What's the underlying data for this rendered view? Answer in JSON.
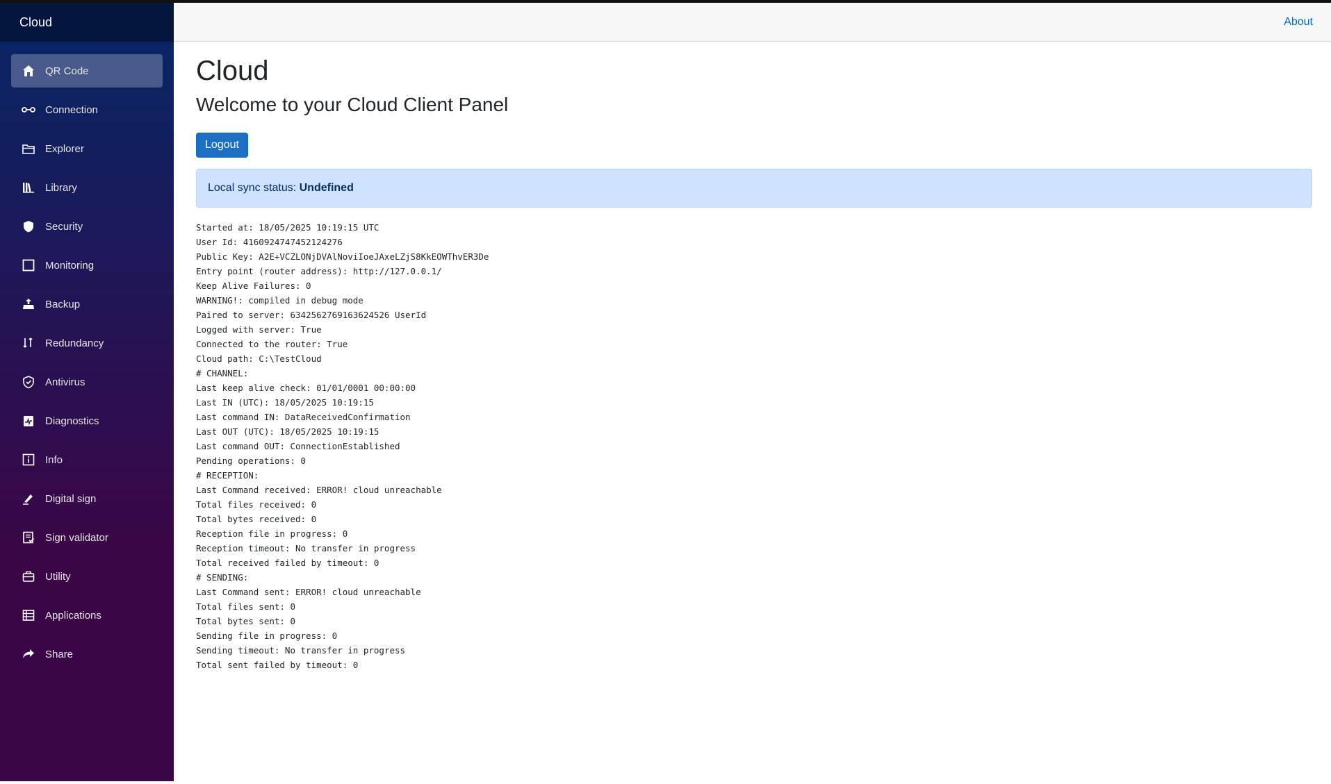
{
  "sidebar": {
    "brand": "Cloud",
    "items": [
      {
        "label": "QR Code",
        "icon": "home-icon",
        "active": true
      },
      {
        "label": "Connection",
        "icon": "connection-icon"
      },
      {
        "label": "Explorer",
        "icon": "folder-icon"
      },
      {
        "label": "Library",
        "icon": "library-icon"
      },
      {
        "label": "Security",
        "icon": "shield-icon"
      },
      {
        "label": "Monitoring",
        "icon": "square-icon"
      },
      {
        "label": "Backup",
        "icon": "backup-icon"
      },
      {
        "label": "Redundancy",
        "icon": "redundancy-icon"
      },
      {
        "label": "Antivirus",
        "icon": "shield-check-icon"
      },
      {
        "label": "Diagnostics",
        "icon": "diagnostics-icon"
      },
      {
        "label": "Info",
        "icon": "info-icon"
      },
      {
        "label": "Digital sign",
        "icon": "pen-icon"
      },
      {
        "label": "Sign validator",
        "icon": "document-check-icon"
      },
      {
        "label": "Utility",
        "icon": "toolbox-icon"
      },
      {
        "label": "Applications",
        "icon": "table-icon"
      },
      {
        "label": "Share",
        "icon": "share-icon"
      }
    ]
  },
  "topbar": {
    "about": "About"
  },
  "main": {
    "title": "Cloud",
    "subtitle": "Welcome to your Cloud Client Panel",
    "logout_label": "Logout",
    "sync_label": "Local sync status: ",
    "sync_status": "Undefined",
    "log_lines": [
      "Started at: 18/05/2025 10:19:15 UTC",
      "User Id: 4160924747452124276",
      "Public Key: A2E+VCZLONjDVAlNoviIoeJAxeLZjS8KkEOWThvER3De",
      "Entry point (router address): http://127.0.0.1/",
      "Keep Alive Failures: 0",
      "WARNING!: compiled in debug mode",
      "Paired to server: 6342562769163624526 UserId",
      "Logged with server: True",
      "Connected to the router: True",
      "Cloud path: C:\\TestCloud",
      "# CHANNEL:",
      "Last keep alive check: 01/01/0001 00:00:00",
      "Last IN (UTC): 18/05/2025 10:19:15",
      "Last command IN: DataReceivedConfirmation",
      "Last OUT (UTC): 18/05/2025 10:19:15",
      "Last command OUT: ConnectionEstablished",
      "Pending operations: 0",
      "# RECEPTION:",
      "Last Command received: ERROR! cloud unreachable",
      "Total files received: 0",
      "Total bytes received: 0",
      "Reception file in progress: 0",
      "Reception timeout: No transfer in progress",
      "Total received failed by timeout: 0",
      "# SENDING:",
      "Last Command sent: ERROR! cloud unreachable",
      "Total files sent: 0",
      "Total bytes sent: 0",
      "Sending file in progress: 0",
      "Sending timeout: No transfer in progress",
      "Total sent failed by timeout: 0"
    ]
  },
  "colors": {
    "sidebar_top": "#052767",
    "sidebar_bottom": "#3a0647",
    "accent": "#1b6ec2",
    "alert_bg": "#cfe2ff"
  }
}
